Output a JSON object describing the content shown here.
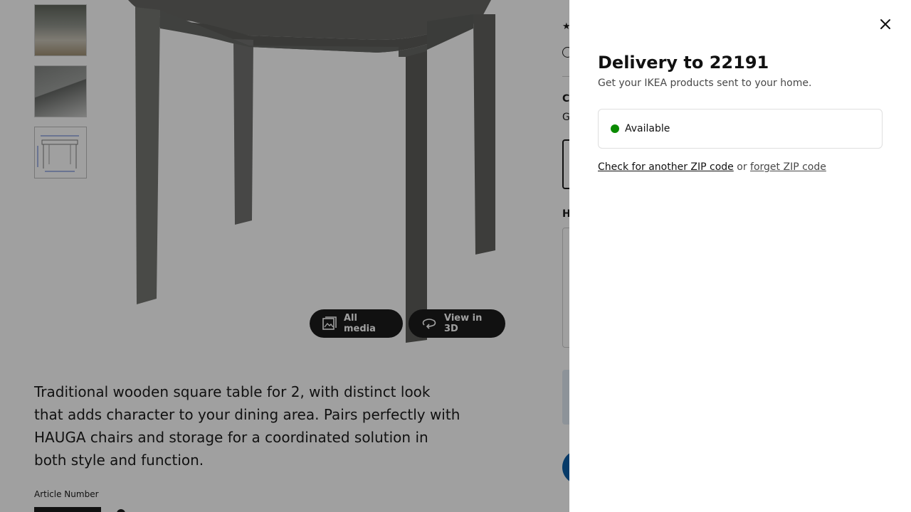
{
  "product_page": {
    "media_buttons": {
      "all_media": "All media",
      "view_in_3d": "View in 3D"
    },
    "description": "Traditional wooden square table for 2, with distinct look that adds character to your dining area. Pairs perfectly with HAUGA chairs and storage for a coordinated solution in both style and function.",
    "article_number_label": "Article Number",
    "right_column_fragments": {
      "section_c": "C",
      "color_g": "G",
      "section_h": "H"
    }
  },
  "delivery_panel": {
    "title": "Delivery to 22191",
    "subtitle": "Get your IKEA products sent to your home.",
    "availability": "Available",
    "availability_color": "#0a8a00",
    "check_link": "Check for another ZIP code",
    "or_text": " or ",
    "forget_link": "forget ZIP code"
  },
  "icons": {
    "close": "close-icon",
    "all_media": "images-icon",
    "view_3d": "rotate-3d-icon",
    "star": "star-icon",
    "info": "info-icon"
  },
  "colors": {
    "overlay": "rgba(17,17,17,0.4)",
    "primary_blue": "#0058a3"
  }
}
